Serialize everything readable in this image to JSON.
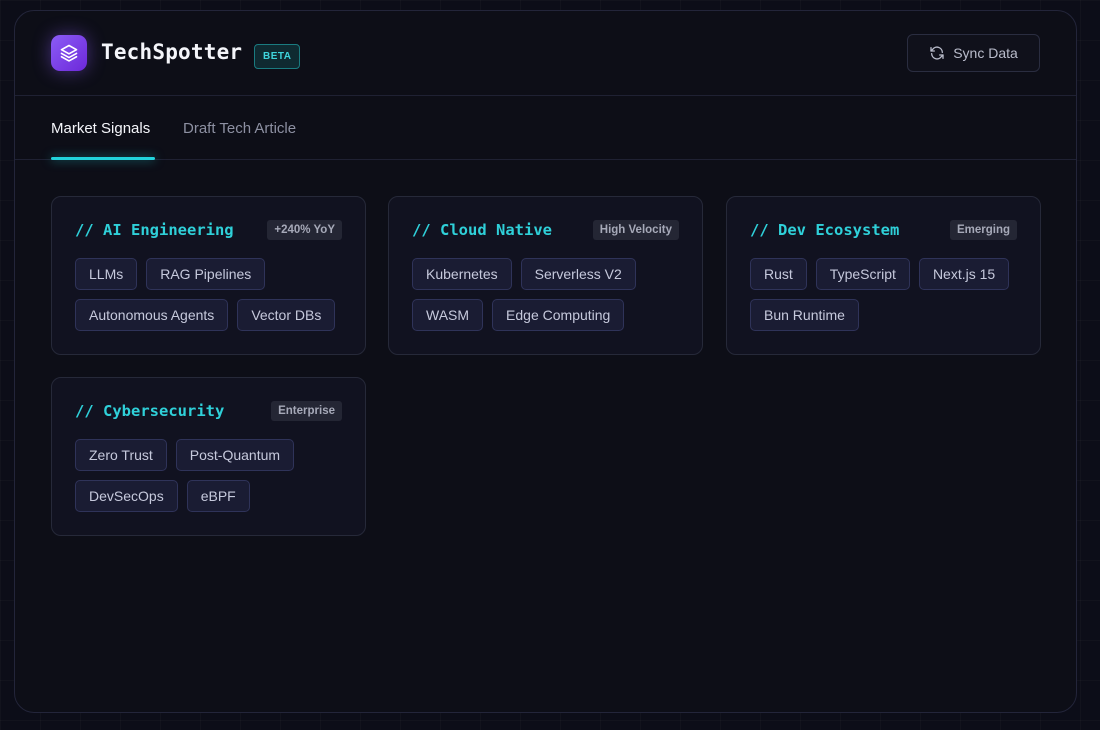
{
  "header": {
    "app_name": "TechSpotter",
    "badge": "BETA",
    "sync_label": "Sync Data",
    "logo_icon": "layers-icon",
    "sync_icon": "refresh-icon",
    "accent": "#22d3dc",
    "brand_color": "#8b5cf6"
  },
  "tabs": [
    {
      "label": "Market Signals",
      "active": true
    },
    {
      "label": "Draft Tech Article",
      "active": false
    }
  ],
  "cards": [
    {
      "title": "// AI Engineering",
      "badge": "+240% YoY",
      "tags": [
        "LLMs",
        "RAG Pipelines",
        "Autonomous Agents",
        "Vector DBs"
      ]
    },
    {
      "title": "// Cloud Native",
      "badge": "High Velocity",
      "tags": [
        "Kubernetes",
        "Serverless V2",
        "WASM",
        "Edge Computing"
      ]
    },
    {
      "title": "// Dev Ecosystem",
      "badge": "Emerging",
      "tags": [
        "Rust",
        "TypeScript",
        "Next.js 15",
        "Bun Runtime"
      ]
    },
    {
      "title": "// Cybersecurity",
      "badge": "Enterprise",
      "tags": [
        "Zero Trust",
        "Post-Quantum",
        "DevSecOps",
        "eBPF"
      ]
    }
  ]
}
